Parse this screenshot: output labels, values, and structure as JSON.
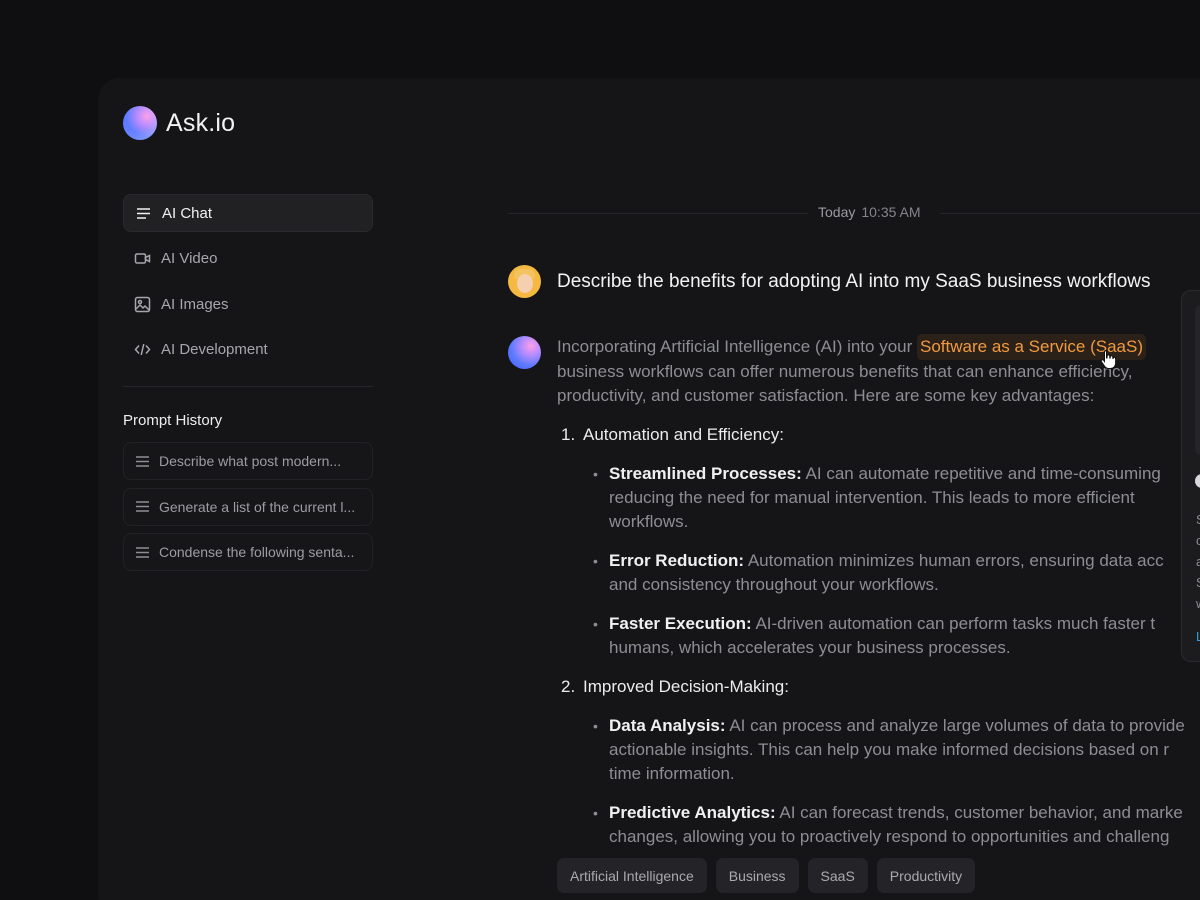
{
  "brand": {
    "name": "Ask.io"
  },
  "nav": {
    "items": [
      {
        "label": "AI Chat",
        "icon": "menu-lines-icon",
        "active": true
      },
      {
        "label": "AI Video",
        "icon": "video-icon"
      },
      {
        "label": "AI Images",
        "icon": "image-icon"
      },
      {
        "label": "AI Development",
        "icon": "code-icon"
      }
    ]
  },
  "history": {
    "title": "Prompt History",
    "items": [
      {
        "label": "Describe what post modern..."
      },
      {
        "label": "Generate a list of the current l..."
      },
      {
        "label": "Condense the following senta..."
      }
    ]
  },
  "chat": {
    "date_label": "Today",
    "time_label": "10:35 AM",
    "user_question": "Describe the benefits for adopting AI into my SaaS business workflows",
    "intro": {
      "before": "Incorporating Artificial Intelligence (AI) into your ",
      "highlight": "Software as a Service (SaaS)",
      "line2": "business workflows can offer numerous benefits that can enhance efficiency,",
      "line3": "productivity, and customer satisfaction. Here are some key advantages:"
    },
    "sections": [
      {
        "number": "1.",
        "title": "Automation and Efficiency:",
        "bullets": [
          {
            "title": "Streamlined Processes:",
            "line1": " AI can automate repetitive and time-consuming",
            "line2": "reducing the need for manual intervention. This leads to more efficient",
            "line3": "workflows."
          },
          {
            "title": "Error Reduction:",
            "line1": " Automation minimizes human errors, ensuring data acc",
            "line2": "and consistency throughout your workflows."
          },
          {
            "title": "Faster Execution:",
            "line1": " AI-driven automation can perform tasks much faster t",
            "line2": "humans, which accelerates your business processes."
          }
        ]
      },
      {
        "number": "2.",
        "title": "Improved Decision-Making:",
        "bullets": [
          {
            "title": "Data Analysis:",
            "line1": " AI can process and analyze large volumes of data to provide",
            "line2": "actionable insights. This can help you make informed decisions based on r",
            "line3": "time information."
          },
          {
            "title": "Predictive Analytics:",
            "line1": " AI can forecast trends, customer behavior, and marke",
            "line2": "changes, allowing you to proactively respond to opportunities and challeng"
          }
        ]
      }
    ],
    "tags": [
      "Artificial Intelligence",
      "Business",
      "SaaS",
      "Productivity"
    ]
  },
  "popover": {
    "lines": [
      "S",
      "c",
      "a",
      "S",
      "w"
    ],
    "link": "L"
  },
  "colors": {
    "background": "#0f0f11",
    "panel": "#151517",
    "highlight": "#f19a3e",
    "link": "#3b9bd8"
  }
}
